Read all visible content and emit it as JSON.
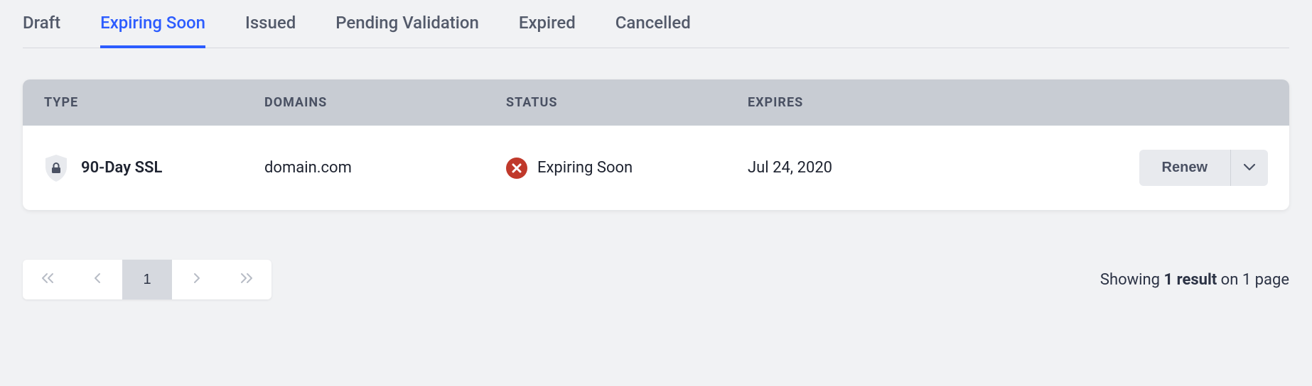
{
  "tabs": [
    {
      "label": "Draft",
      "active": false
    },
    {
      "label": "Expiring Soon",
      "active": true
    },
    {
      "label": "Issued",
      "active": false
    },
    {
      "label": "Pending Validation",
      "active": false
    },
    {
      "label": "Expired",
      "active": false
    },
    {
      "label": "Cancelled",
      "active": false
    }
  ],
  "table": {
    "headers": {
      "type": "TYPE",
      "domains": "DOMAINS",
      "status": "STATUS",
      "expires": "EXPIRES"
    },
    "row": {
      "type": "90-Day SSL",
      "domain": "domain.com",
      "status": "Expiring Soon",
      "expires": "Jul 24, 2020",
      "action_label": "Renew"
    }
  },
  "pagination": {
    "current": "1",
    "summary_prefix": "Showing ",
    "summary_bold": "1 result",
    "summary_suffix": " on 1 page"
  }
}
